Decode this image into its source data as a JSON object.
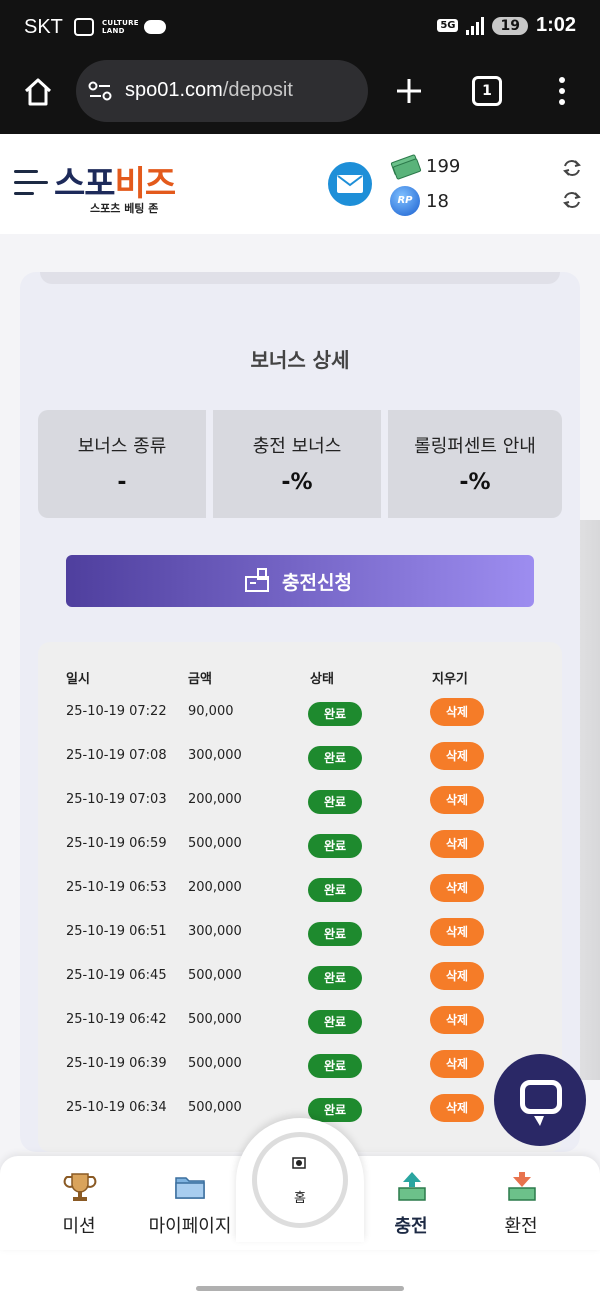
{
  "status_bar": {
    "carrier": "SKT",
    "culture_land": "CULTURE LAND",
    "network": "5G",
    "battery": "19",
    "time": "1:02"
  },
  "browser": {
    "url_host": "spo01.com",
    "url_path": "/deposit",
    "tab_count": "1"
  },
  "header": {
    "logo_part1": "스포",
    "logo_part2": "비즈",
    "logo_sub": "스포츠 베팅 존",
    "money_value": "199",
    "rp_icon_text": "RP",
    "rp_value": "18"
  },
  "bonus": {
    "title": "보너스 상세",
    "boxes": [
      {
        "label": "보너스 종류",
        "value": "-"
      },
      {
        "label": "충전 보너스",
        "value": "-%"
      },
      {
        "label": "롤링퍼센트 안내",
        "value": "-%"
      }
    ]
  },
  "deposit_button": {
    "label": "충전신청"
  },
  "table": {
    "headers": [
      "일시",
      "금액",
      "상태",
      "지우기"
    ],
    "rows": [
      {
        "date": "25-10-19 07:22",
        "amount": "90,000",
        "status": "완료",
        "action": "삭제"
      },
      {
        "date": "25-10-19 07:08",
        "amount": "300,000",
        "status": "완료",
        "action": "삭제"
      },
      {
        "date": "25-10-19 07:03",
        "amount": "200,000",
        "status": "완료",
        "action": "삭제"
      },
      {
        "date": "25-10-19 06:59",
        "amount": "500,000",
        "status": "완료",
        "action": "삭제"
      },
      {
        "date": "25-10-19 06:53",
        "amount": "200,000",
        "status": "완료",
        "action": "삭제"
      },
      {
        "date": "25-10-19 06:51",
        "amount": "300,000",
        "status": "완료",
        "action": "삭제"
      },
      {
        "date": "25-10-19 06:45",
        "amount": "500,000",
        "status": "완료",
        "action": "삭제"
      },
      {
        "date": "25-10-19 06:42",
        "amount": "500,000",
        "status": "완료",
        "action": "삭제"
      },
      {
        "date": "25-10-19 06:39",
        "amount": "500,000",
        "status": "완료",
        "action": "삭제"
      },
      {
        "date": "25-10-19 06:34",
        "amount": "500,000",
        "status": "완료",
        "action": "삭제"
      }
    ]
  },
  "bottom_nav": {
    "mission": "미션",
    "mypage": "마이페이지",
    "home": "홈",
    "deposit": "충전",
    "withdraw": "환전"
  },
  "colors": {
    "accent_purple": "#4f3f9e",
    "status_done": "#1e8a2e",
    "delete_orange": "#f57c28",
    "chat_navy": "#2a2866"
  },
  "icons": {
    "home": "home-icon",
    "mail": "mail-icon",
    "chat": "chat-icon",
    "refresh": "refresh-icon"
  }
}
